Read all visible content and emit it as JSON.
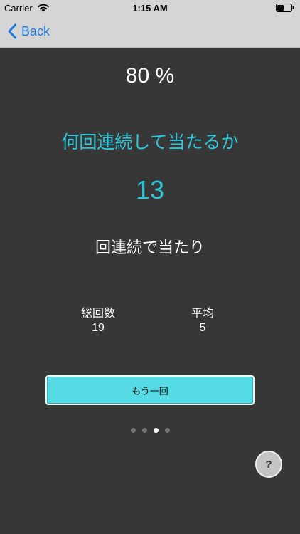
{
  "status_bar": {
    "carrier": "Carrier",
    "time": "1:15 AM",
    "icons": [
      "wifi-icon",
      "battery-icon"
    ]
  },
  "nav": {
    "back_label": "Back",
    "accent_color": "#1f7ae0"
  },
  "main": {
    "percentage": "80 %",
    "question": "何回連続して当たるか",
    "result_number": "13",
    "result_caption": "回連続で当たり",
    "accent_color": "#2cc6d9",
    "stats": {
      "total_label": "総回数",
      "total_value": "19",
      "average_label": "平均",
      "average_value": "5"
    },
    "retry_label": "もう一回",
    "page_control": {
      "page_count": 4,
      "current_page": 3
    },
    "help_label": "?"
  }
}
